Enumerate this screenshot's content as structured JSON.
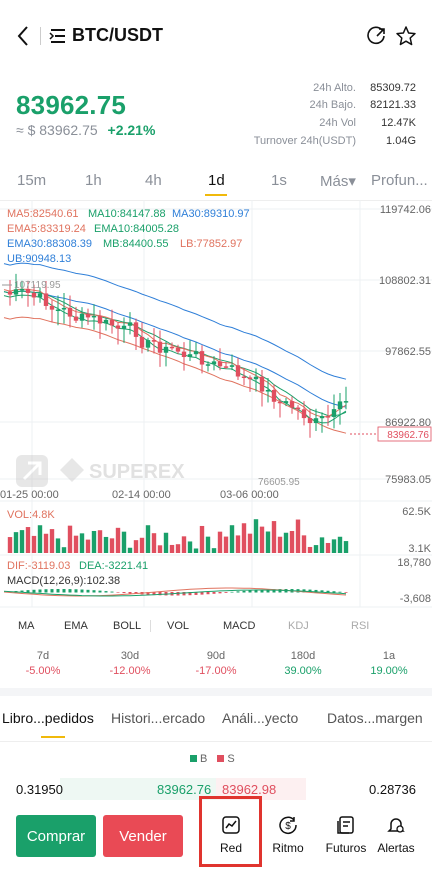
{
  "header": {
    "pair": "BTC/USDT",
    "icons": [
      "back-icon",
      "menu-icon",
      "share-icon",
      "star-icon"
    ]
  },
  "ticker": {
    "last": "83962.75",
    "approx_usd": "≈ $ 83962.75",
    "change": "+2.21%",
    "stats": [
      {
        "label": "24h Alto.",
        "value": "85309.72"
      },
      {
        "label": "24h Bajo.",
        "value": "82121.33"
      },
      {
        "label": "24h Vol",
        "value": "12.47K"
      },
      {
        "label": "Turnover 24h(USDT)",
        "value": "1.04G"
      }
    ]
  },
  "timeframes": [
    "15m",
    "1h",
    "4h",
    "1d",
    "1s",
    "Más▾",
    "Profun..."
  ],
  "active_timeframe": "1d",
  "chart": {
    "ma_lines": {
      "ma5": "MA5:82540.61",
      "ma10": "MA10:84147.88",
      "ma30": "MA30:89310.97",
      "ema5": "EMA5:83319.24",
      "ema10": "EMA10:84005.28",
      "ema30": "EMA30:88308.39",
      "mb": "MB:84400.55",
      "lb": "LB:77852.97",
      "ub": "UB:90948.13"
    },
    "price_ticks": [
      "119742.06",
      "108802.31",
      "97862.55",
      "86922.80",
      "75983.05"
    ],
    "current_price_tag": "83962.76",
    "high_marker": "107119.95",
    "low_marker": "76605.95",
    "date_ticks": [
      "01-25 00:00",
      "02-14 00:00",
      "03-06 00:00"
    ],
    "watermark": "SUPEREX",
    "vol_label": "VOL:4.8K",
    "vol_ticks": [
      "62.5K",
      "3.1K"
    ],
    "macd_labels": {
      "dif": "DIF:-3119.03",
      "dea": "DEA:-3221.41",
      "macd": "MACD(12,26,9):102.38"
    },
    "macd_ticks": [
      "18,780",
      "-3,608"
    ],
    "colors": {
      "up": "#1aa06a",
      "down": "#e04f5f",
      "ma5": "#e0735f",
      "ma10": "#1aa06a",
      "ma30": "#2f7fd8",
      "ub": "#2f7fd8",
      "lb": "#e0735f"
    }
  },
  "indicator_tabs": [
    "MA",
    "EMA",
    "BOLL",
    "VOL",
    "MACD",
    "KDJ",
    "RSI"
  ],
  "performance": [
    {
      "period": "7d",
      "value": "-5.00%"
    },
    {
      "period": "30d",
      "value": "-12.00%"
    },
    {
      "period": "90d",
      "value": "-17.00%"
    },
    {
      "period": "180d",
      "value": "39.00%"
    },
    {
      "period": "1a",
      "value": "19.00%"
    }
  ],
  "section_tabs": [
    "Libro...pedidos",
    "Histori...ercado",
    "Análi...yecto",
    "Datos...margen"
  ],
  "orderbook": {
    "legend_b": "B",
    "legend_s": "S",
    "row": {
      "bid_qty": "0.31950",
      "bid_price": "83962.76",
      "ask_price": "83962.98",
      "ask_qty": "0.28736"
    }
  },
  "bottom": {
    "buy": "Comprar",
    "sell": "Vender",
    "nav": [
      {
        "label": "Red",
        "icon": "chart-line-icon"
      },
      {
        "label": "Ritmo",
        "icon": "dollar-cycle-icon"
      },
      {
        "label": "Futuros",
        "icon": "document-icon"
      },
      {
        "label": "Alertas",
        "icon": "bell-icon"
      }
    ]
  }
}
